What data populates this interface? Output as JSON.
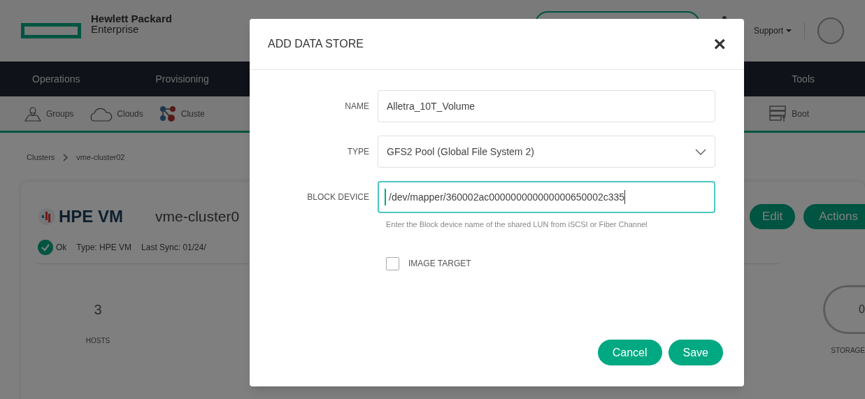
{
  "header": {
    "logo_line1": "Hewlett Packard",
    "logo_line2": "Enterprise",
    "support": "Support"
  },
  "nav": [
    {
      "label": "Operations"
    },
    {
      "label": "Provisioning"
    },
    {
      "label": "Tools"
    }
  ],
  "subnav": [
    {
      "label": "Groups",
      "kind": "pin"
    },
    {
      "label": "Clouds",
      "kind": "cloud"
    },
    {
      "label": "Cluste",
      "kind": "nodes"
    },
    {
      "label": "Boot",
      "kind": "server"
    }
  ],
  "breadcrumb": [
    "Clusters",
    "vme-cluster02"
  ],
  "cluster": {
    "brand": "HPE VM",
    "name": "vme-cluster0",
    "status": "Ok",
    "type": "Type: HPE VM",
    "last_sync": "Last Sync: 01/24/",
    "hosts_count": "3",
    "hosts_label": "HOSTS",
    "storage_value": "0",
    "storage_label": "STORAGE",
    "edit": "Edit",
    "actions": "Actions"
  },
  "dialog": {
    "title": "ADD DATA STORE",
    "close": "×",
    "fields": [
      {
        "label": "NAME",
        "kind": "text",
        "value": "Alletra_10T_Volume",
        "focused": false
      },
      {
        "label": "TYPE",
        "kind": "select",
        "value": "GFS2 Pool (Global File System 2)",
        "focused": false
      },
      {
        "label": "BLOCK DEVICE",
        "kind": "text",
        "value": "/dev/mapper/360002ac000000000000000650002c335",
        "focused": true,
        "hint": "Enter the Block device name of the shared LUN from iSCSI or Fiber Channel"
      }
    ],
    "image_target": {
      "label": "IMAGE TARGET",
      "checked": false
    },
    "buttons": [
      "Cancel",
      "Save"
    ]
  }
}
